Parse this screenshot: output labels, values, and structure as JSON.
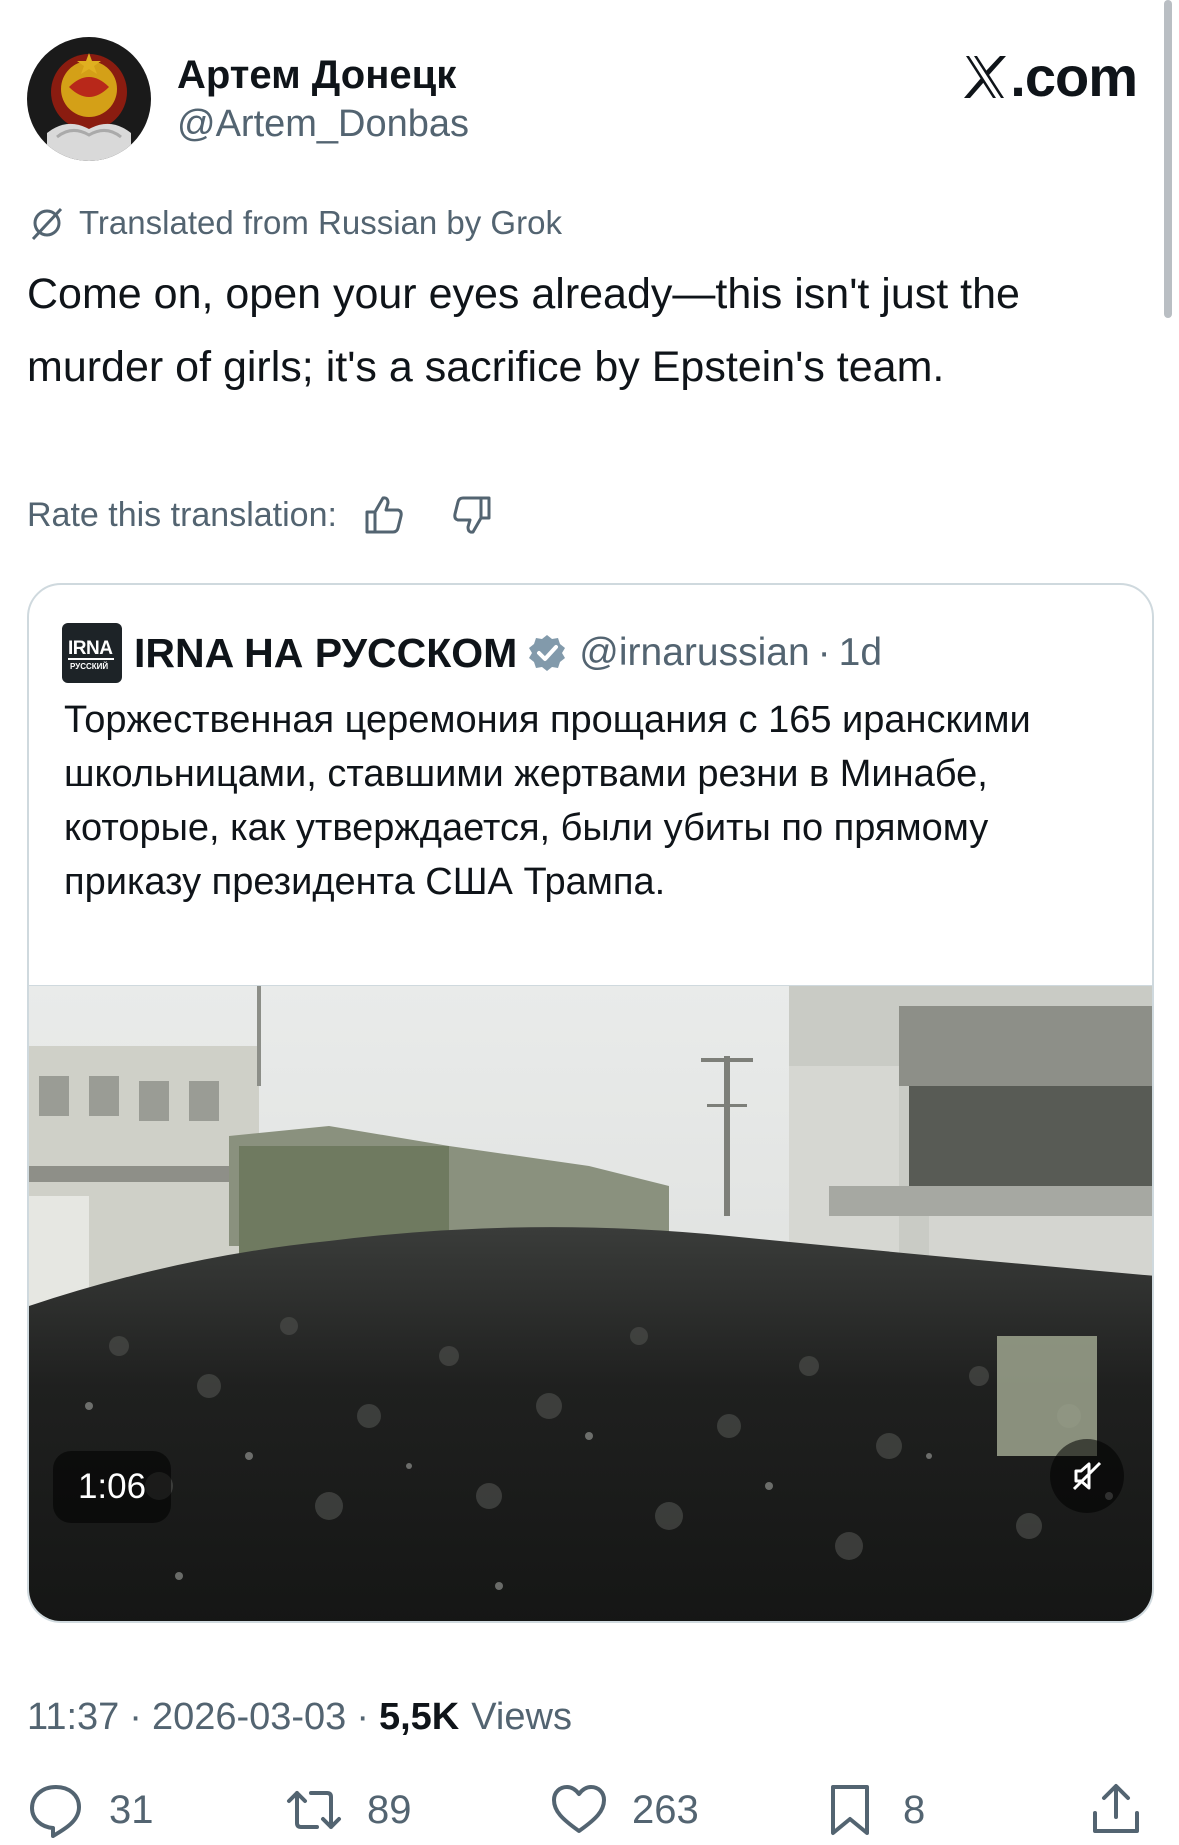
{
  "author": {
    "display_name": "Артем Донецк",
    "handle": "@Artem_Donbas"
  },
  "brand": {
    "text": ".com"
  },
  "translation": {
    "notice": "Translated from Russian by Grok",
    "text": "Come on, open your eyes already—this isn't just the murder of girls; it's a sacrifice by Epstein's team.",
    "rate_label": "Rate this translation:"
  },
  "quote": {
    "logo_text": "IRNA",
    "logo_subtext": "РУССКИЙ",
    "display_name": "IRNA НА РУССКОМ",
    "handle": "@irnarussian",
    "separator": "·",
    "time": "1d",
    "text": "Торжественная церемония прощания с 165 иранскими школьницами, ставшими жертвами резни в Минабе, которые, как утверждается, были убиты по прямому приказу президента США Трампа.",
    "video": {
      "duration": "1:06"
    }
  },
  "meta": {
    "time": "11:37",
    "date": "2026-03-03",
    "separator": "·",
    "views_count": "5,5K",
    "views_label": "Views"
  },
  "actions": {
    "replies": "31",
    "reposts": "89",
    "likes": "263",
    "bookmarks": "8"
  },
  "colors": {
    "text": "#0f1419",
    "secondary": "#536471",
    "border": "#cfd9de",
    "verified_badge": "#829aab"
  }
}
